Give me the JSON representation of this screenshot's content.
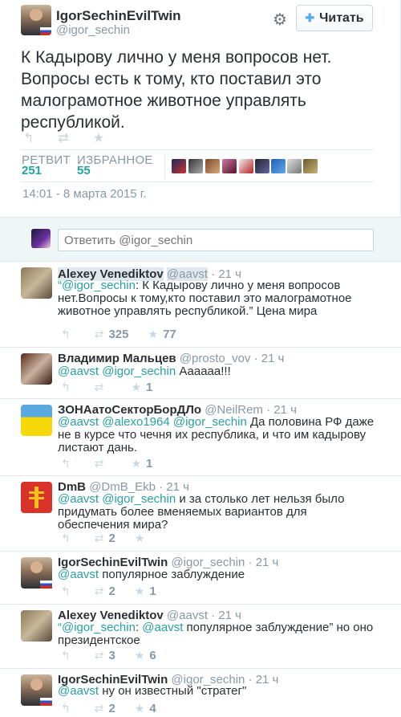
{
  "tweet": {
    "name": "IgorSechinEvilTwin",
    "handle": "@igor_sechin",
    "follow_label": "Читать",
    "text": "К Кадырову лично у меня вопросов нет. Вопросы есть к тому, кто поставил это малограмотное животное управлять республикой.",
    "retweet_label": "РЕТВИТ",
    "retweet_count": "251",
    "fav_label": "ИЗБРАННОЕ",
    "fav_count": "55",
    "time": "14:01 - 8 марта 2015 г."
  },
  "reply_box": {
    "placeholder": "Ответить @igor_sechin"
  },
  "replies": [
    {
      "name": "Alexey Venediktov",
      "handle": "@aavst",
      "time": "· 21 ч",
      "mention": "“@igor_sechin",
      "text": ": К Кадырову лично у меня вопросов нет.Вопросы к тому,кто поставил это малограмотное животное управлять республикой.” Цена мира",
      "retweets": "325",
      "favs": "77"
    },
    {
      "name": "Владимир Мальцев",
      "handle": "@prosto_vov",
      "time": "· 21 ч",
      "mention": "@aavst @igor_sechin",
      "text": " Аааааа!!!",
      "retweets": "",
      "favs": "1"
    },
    {
      "name": "ЗОНАатоСекторБорДЛо",
      "handle": "@NeilRem",
      "time": "· 21 ч",
      "mention": "@aavst @alexo1964 @igor_sechin",
      "text": " Да половина РФ даже не в курсе что чечня их республика, и что им кадырову листают дань.",
      "retweets": "",
      "favs": "1"
    },
    {
      "name": "DmB",
      "handle": "@DmB_Ekb",
      "time": "· 21 ч",
      "mention": "@aavst @igor_sechin",
      "text": " и за столько лет нельзя было придумать более вменяемых вариантов для обеспечения мира?",
      "retweets": "2",
      "favs": ""
    },
    {
      "name": "IgorSechinEvilTwin",
      "handle": "@igor_sechin",
      "time": "· 21 ч",
      "mention": "@aavst",
      "text": " популярное заблуждение",
      "retweets": "2",
      "favs": "1"
    },
    {
      "name": "Alexey Venediktov",
      "handle": "@aavst",
      "time": "· 21 ч",
      "mention": "“@igor_sechin",
      "text": ": ",
      "mention2": "@aavst",
      "text2": " популярное заблуждение” но оно президентское",
      "retweets": "3",
      "favs": "6"
    },
    {
      "name": "IgorSechinEvilTwin",
      "handle": "@igor_sechin",
      "time": "· 21 ч",
      "mention": "@aavst",
      "text": " ну он известный \"стратег\"",
      "retweets": "2",
      "favs": "4"
    }
  ],
  "icons": {
    "reply": "↰",
    "retweet": "⇄",
    "favorite": "★",
    "gear": "⚙",
    "follow": "👤"
  }
}
